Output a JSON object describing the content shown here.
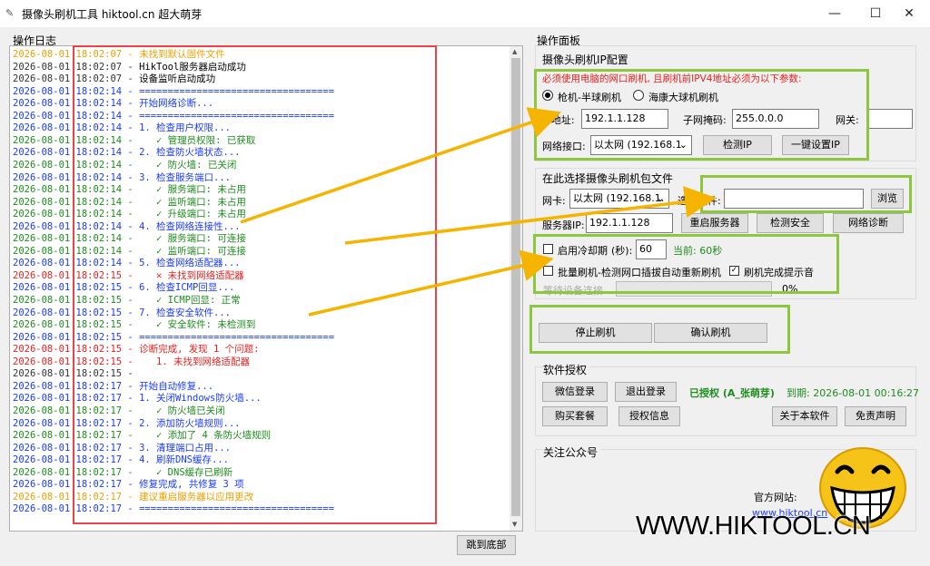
{
  "window": {
    "title": "摄像头刷机工具 hiktool.cn 超大萌芽",
    "minimize": "—",
    "maximize": "☐",
    "close": "✕"
  },
  "log": {
    "label": "操作日志",
    "jump_button": "跳到底部",
    "lines": [
      {
        "ts": "2026-08-01",
        "time": "18:02:07",
        "msg": "未找到默认固件文件",
        "color": "#f0a000"
      },
      {
        "ts": "2026-08-01",
        "time": "18:02:07",
        "msg": "HikTool服务器启动成功",
        "color": "#000000"
      },
      {
        "ts": "2026-08-01",
        "time": "18:02:07",
        "msg": "设备监听启动成功",
        "color": "#000000"
      },
      {
        "ts": "2026-08-01",
        "time": "18:02:14",
        "msg": "==================================",
        "color": "#1a3cff"
      },
      {
        "ts": "2026-08-01",
        "time": "18:02:14",
        "msg": "开始网络诊断...",
        "color": "#1a3cff"
      },
      {
        "ts": "2026-08-01",
        "time": "18:02:14",
        "msg": "==================================",
        "color": "#1a3cff"
      },
      {
        "ts": "2026-08-01",
        "time": "18:02:14",
        "msg": "1. 检查用户权限...",
        "color": "#1a3cff"
      },
      {
        "ts": "2026-08-01",
        "time": "18:02:14",
        "msg": "   ✓ 管理员权限: 已获取",
        "color": "#1e8c1e",
        "check": true
      },
      {
        "ts": "2026-08-01",
        "time": "18:02:14",
        "msg": "2. 检查防火墙状态...",
        "color": "#1a3cff"
      },
      {
        "ts": "2026-08-01",
        "time": "18:02:14",
        "msg": "   ✓ 防火墙: 已关闭",
        "color": "#1e8c1e",
        "check": true
      },
      {
        "ts": "2026-08-01",
        "time": "18:02:14",
        "msg": "3. 检查服务端口...",
        "color": "#1a3cff"
      },
      {
        "ts": "2026-08-01",
        "time": "18:02:14",
        "msg": "   ✓ 服务端口: 未占用",
        "color": "#1e8c1e",
        "check": true
      },
      {
        "ts": "2026-08-01",
        "time": "18:02:14",
        "msg": "   ✓ 监听端口: 未占用",
        "color": "#1e8c1e",
        "check": true
      },
      {
        "ts": "2026-08-01",
        "time": "18:02:14",
        "msg": "   ✓ 升级端口: 未占用",
        "color": "#1e8c1e",
        "check": true
      },
      {
        "ts": "2026-08-01",
        "time": "18:02:14",
        "msg": "4. 检查网络连接性...",
        "color": "#1a3cff"
      },
      {
        "ts": "2026-08-01",
        "time": "18:02:14",
        "msg": "   ✓ 服务端口: 可连接",
        "color": "#1e8c1e",
        "check": true
      },
      {
        "ts": "2026-08-01",
        "time": "18:02:14",
        "msg": "   ✓ 监听端口: 可连接",
        "color": "#1e8c1e",
        "check": true
      },
      {
        "ts": "2026-08-01",
        "time": "18:02:14",
        "msg": "5. 检查网络适配器...",
        "color": "#1a3cff"
      },
      {
        "ts": "2026-08-01",
        "time": "18:02:15",
        "msg": "   ✕ 未找到网络适配器",
        "color": "#e82020",
        "cross": true
      },
      {
        "ts": "2026-08-01",
        "time": "18:02:15",
        "msg": "6. 检查ICMP回显...",
        "color": "#1a3cff"
      },
      {
        "ts": "2026-08-01",
        "time": "18:02:15",
        "msg": "   ✓ ICMP回显: 正常",
        "color": "#1e8c1e",
        "check": true
      },
      {
        "ts": "2026-08-01",
        "time": "18:02:15",
        "msg": "7. 检查安全软件...",
        "color": "#1a3cff"
      },
      {
        "ts": "2026-08-01",
        "time": "18:02:15",
        "msg": "   ✓ 安全软件: 未检测到",
        "color": "#1e8c1e",
        "check": true
      },
      {
        "ts": "2026-08-01",
        "time": "18:02:15",
        "msg": "==================================",
        "color": "#1a3cff"
      },
      {
        "ts": "2026-08-01",
        "time": "18:02:15",
        "msg": "诊断完成, 发现 1 个问题:",
        "color": "#e82020"
      },
      {
        "ts": "2026-08-01",
        "time": "18:02:15",
        "msg": "   1. 未找到网络适配器",
        "color": "#e82020"
      },
      {
        "ts": "2026-08-01",
        "time": "18:02:15",
        "msg": "",
        "color": "#000000"
      },
      {
        "ts": "2026-08-01",
        "time": "18:02:17",
        "msg": "开始自动修复...",
        "color": "#1a3cff"
      },
      {
        "ts": "2026-08-01",
        "time": "18:02:17",
        "msg": "1. 关闭Windows防火墙...",
        "color": "#1a3cff"
      },
      {
        "ts": "2026-08-01",
        "time": "18:02:17",
        "msg": "   ✓ 防火墙已关闭",
        "color": "#1e8c1e",
        "check": true
      },
      {
        "ts": "2026-08-01",
        "time": "18:02:17",
        "msg": "2. 添加防火墙规则...",
        "color": "#1a3cff"
      },
      {
        "ts": "2026-08-01",
        "time": "18:02:17",
        "msg": "   ✓ 添加了 4 条防火墙规则",
        "color": "#1e8c1e",
        "check": true
      },
      {
        "ts": "2026-08-01",
        "time": "18:02:17",
        "msg": "3. 清理端口占用...",
        "color": "#1a3cff"
      },
      {
        "ts": "2026-08-01",
        "time": "18:02:17",
        "msg": "4. 刷新DNS缓存...",
        "color": "#1a3cff"
      },
      {
        "ts": "2026-08-01",
        "time": "18:02:17",
        "msg": "   ✓ DNS缓存已刷新",
        "color": "#1e8c1e",
        "check": true
      },
      {
        "ts": "2026-08-01",
        "time": "18:02:17",
        "msg": "修复完成, 共修复 3 项",
        "color": "#1a3cff"
      },
      {
        "ts": "2026-08-01",
        "time": "18:02:17",
        "msg": "建议重启服务器以应用更改",
        "color": "#f0a000"
      },
      {
        "ts": "2026-08-01",
        "time": "18:02:17",
        "msg": "==================================",
        "color": "#1a3cff"
      }
    ]
  },
  "panel": {
    "label": "操作面板",
    "ip_config": {
      "label": "摄像头刷机IP配置",
      "warning": "必须使用电脑的网口刷机, 且刷机前IPV4地址必须为以下参数:",
      "radio_gun": "枪机-半球刷机",
      "radio_dome": "海康大球机刷机",
      "ip_label": "IP地址:",
      "ip_value": "192.1.1.128",
      "mask_label": "子网掩码:",
      "mask_value": "255.0.0.0",
      "gateway_label": "网关:",
      "iface_label": "网络接口:",
      "iface_value": "以太网 (192.168.1.",
      "detect_ip": "检测IP",
      "one_click": "一键设置IP"
    },
    "firmware": {
      "label": "在此选择摄像头刷机包文件",
      "nic_label": "网卡:",
      "nic_value": "以太网 (192.168.1.",
      "file_label": "选择文件:",
      "browse": "浏览",
      "server_label": "服务器IP:",
      "server_value": "192.1.1.128",
      "restart_server": "重启服务器",
      "check_security": "检测安全",
      "net_diag": "网络诊断"
    },
    "options": {
      "cooling_label": "启用冷却期",
      "seconds_label": "(秒):",
      "cooling_value": "60",
      "current": "当前: 60秒",
      "batch_label": "批量刷机-检测网口插拔自动重新刷机",
      "sound_label": "刷机完成提示音",
      "waiting": "等待设备连接",
      "progress": "0%",
      "progress_value": 0
    },
    "actions": {
      "stop": "停止刷机",
      "confirm": "确认刷机"
    },
    "license": {
      "label": "软件授权",
      "wechat_login": "微信登录",
      "logout": "退出登录",
      "status": "已授权 (A_张萌芽)",
      "expiry": "到期: 2026-08-01 00:16:27",
      "buy": "购买套餐",
      "auth_info": "授权信息",
      "about": "关于本软件",
      "disclaimer": "免责声明"
    },
    "follow": {
      "label": "关注公众号",
      "site_label": "官方网站:",
      "site_url": "www.hiktool.cn"
    }
  },
  "watermark": "WWW.HIKTOOL.CN",
  "colors": {
    "accent_green": "#8dc63f",
    "highlight_red": "#e8454b",
    "arrow_yellow": "#f5b400"
  }
}
